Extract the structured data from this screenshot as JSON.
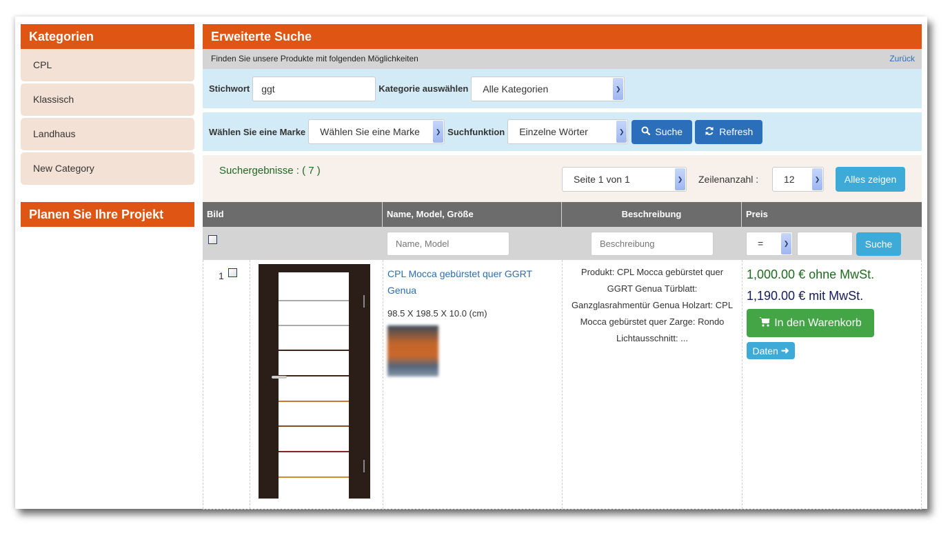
{
  "sidebar": {
    "categories_title": "Kategorien",
    "categories": [
      {
        "label": "CPL"
      },
      {
        "label": "Klassisch"
      },
      {
        "label": "Landhaus"
      },
      {
        "label": "New Category"
      }
    ],
    "project_title": "Planen Sie Ihre Projekt"
  },
  "search": {
    "title": "Erweiterte Suche",
    "subtitle": "Finden Sie unsere Produkte mit folgenden Möglichkeiten",
    "back_link": "Zurück",
    "keyword_label": "Stichwort",
    "keyword_value": "ggt",
    "category_label": "Kategorie auswählen",
    "category_value": "Alle Kategorien",
    "brand_label": "Wählen Sie eine Marke",
    "brand_value": "Wählen Sie eine Marke",
    "function_label": "Suchfunktion",
    "function_value": "Einzelne Wörter",
    "search_button": "Suche",
    "refresh_button": "Refresh"
  },
  "results": {
    "count_text": "Suchergebnisse : ( 7 )",
    "page_value": "Seite 1 von 1",
    "rows_label": "Zeilenanzahl :",
    "rows_value": "12",
    "show_all_button": "Alles zeigen"
  },
  "table": {
    "headers": [
      "Bild",
      "Name, Model, Größe",
      "Beschreibung",
      "Preis"
    ],
    "filters": {
      "name_placeholder": "Name, Model",
      "desc_placeholder": "Beschreibung",
      "price_operator": "=",
      "price_value": "",
      "search_button": "Suche"
    },
    "rows": [
      {
        "index": "1",
        "name": "CPL Mocca gebürstet quer GGRT Genua",
        "size": "98.5 X 198.5 X 10.0 (cm)",
        "description": "Produkt: CPL Mocca gebürstet quer GGRT Genua Türblatt: Ganzglasrahmentür Genua Holzart: CPL Mocca gebürstet quer Zarge: Rondo Lichtausschnitt: ...",
        "price_net": "1,000.00 € ohne MwSt.",
        "price_gross": "1,190.00 € mit MwSt.",
        "cart_button": "In den Warenkorb",
        "details_button": "Daten"
      }
    ]
  },
  "colors": {
    "brand_orange": "#df5513",
    "price_net": "#1e6a1e",
    "price_gross": "#131a5e",
    "cart_green": "#43a545",
    "primary_blue": "#2b6eb9",
    "info_blue": "#3daad7"
  }
}
